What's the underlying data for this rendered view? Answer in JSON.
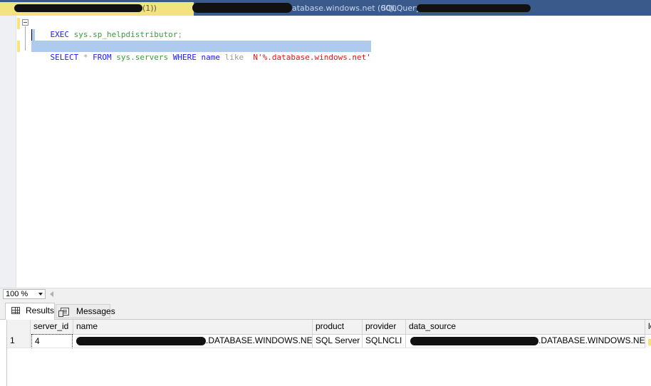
{
  "tabbar": {
    "visible_fragments": [
      "(1))",
      "atabase.windows.net (00))",
      "SQLQuery"
    ]
  },
  "editor": {
    "line1": {
      "keyword": "EXEC",
      "object": "sys.sp_helpdistributor",
      "terminator": ";"
    },
    "line3": {
      "select": "SELECT",
      "star": "*",
      "from": "FROM",
      "table": "sys.servers",
      "where": "WHERE",
      "column": "name",
      "like": "like",
      "literal": "N'%.database.windows.net'"
    }
  },
  "zoom": {
    "value": "100 %"
  },
  "results_tabs": [
    {
      "label": "Results",
      "icon": "grid-icon",
      "active": true
    },
    {
      "label": "Messages",
      "icon": "messages-icon",
      "active": false
    }
  ],
  "grid": {
    "columns": [
      "server_id",
      "name",
      "product",
      "provider",
      "data_source",
      "lo"
    ],
    "rows": [
      {
        "row_number": "1",
        "server_id": "4",
        "name_visible": ".DATABASE.WINDOWS.NET",
        "product": "SQL Server",
        "provider": "SQLNCLI",
        "data_source_visible": ".DATABASE.WINDOWS.NET"
      }
    ]
  },
  "colors": {
    "tab_strip": "#3a5a8c",
    "active_tab": "#f3e37f",
    "selection": "#aecbed",
    "keyword": "#1a1aff",
    "system_object": "#3b9c3b",
    "string_literal": "#e0141d"
  }
}
